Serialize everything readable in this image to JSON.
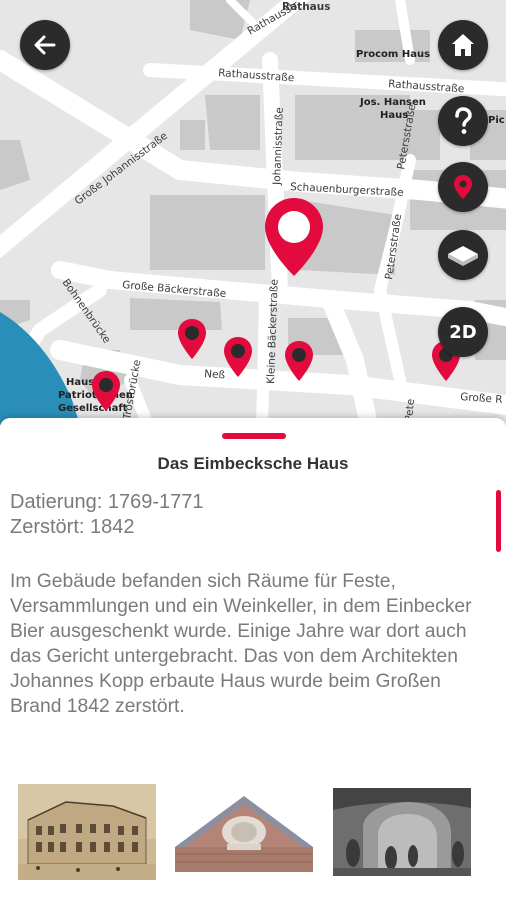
{
  "map": {
    "streets": {
      "rathaus": "Rathaus",
      "rathausstrasse_1": "Rathausstraße",
      "rathausstrasse_2": "Rathausstraße",
      "grosse_johannisstrasse": "Große Johannisstraße",
      "johannisstrasse": "Johannisstraße",
      "schauenburgerstrasse": "Schauenburgerstraße",
      "petersstrasse": "Petersstraße",
      "petersstrasse_top": "Petersstraße",
      "grosse_baeckerstrasse": "Große Bäckerstraße",
      "bohnenbruecke": "Bohnenbrücke",
      "ness": "Neß",
      "kleine_baeckerstrasse": "Kleine Bäckerstraße",
      "trostbruecke": "Trostbrücke",
      "grosse_reichenstrasse": "Große R",
      "pete": "Pete",
      "rathausstr_top": "Rathausstr"
    },
    "buildings": {
      "procom": "Procom Haus",
      "jos_hansen": "Jos. Hansen",
      "haus_label": "Haus",
      "pic": "Pic",
      "haus_patriotischen_1": "Haus",
      "haus_patriotischen_2": "Patriotischen",
      "haus_patriotischen_3": "Gesellschaft"
    },
    "buttons": {
      "dim_label": "2D"
    },
    "colors": {
      "accent": "#e30b3e",
      "button_bg": "#2b2b2b",
      "water": "#2a8fb8"
    }
  },
  "detail": {
    "title": "Das Eimbecksche Haus",
    "dating": "Datierung: 1769-1771",
    "destroyed": "Zerstört: 1842",
    "description": "Im Gebäude befanden sich Räume für Feste, Versammlungen und ein Weinkeller, in dem Einbecker Bier ausgeschenkt wurde. Einige Jahre war dort auch das Gericht untergebracht. Das von dem Architekten Johannes Kopp erbaute Haus wurde beim Großen Brand 1842 zerstört."
  }
}
